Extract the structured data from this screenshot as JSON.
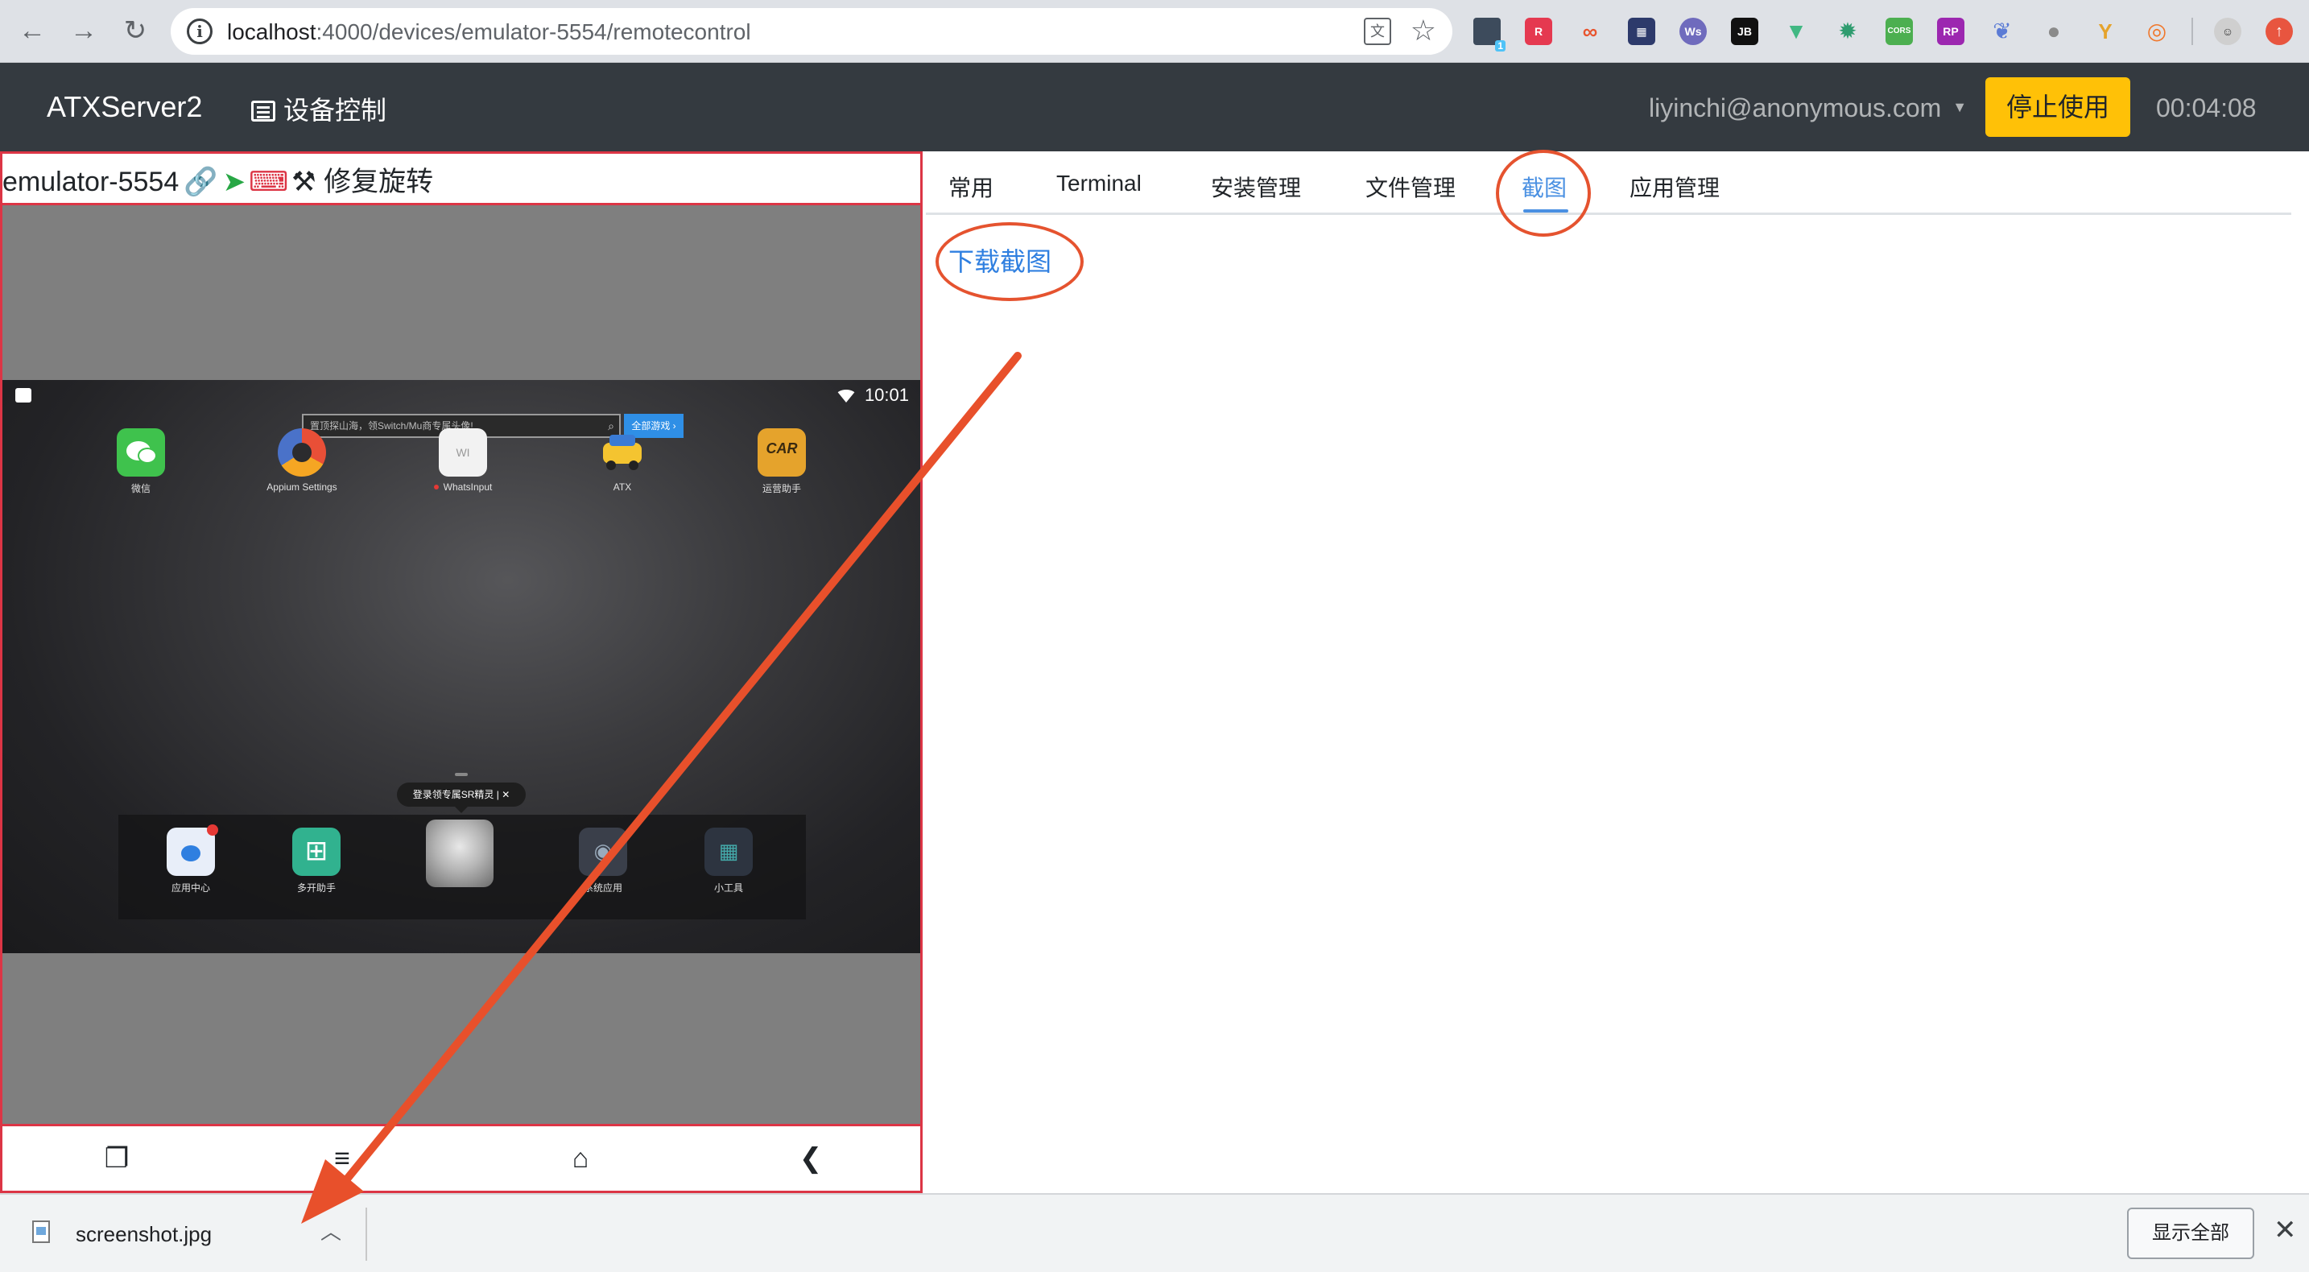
{
  "browser": {
    "url_host": "localhost",
    "url_rest": ":4000/devices/emulator-5554/remotecontrol",
    "extensions": [
      "zoom-ext",
      "rx-ext",
      "loop-ext",
      "img-ext",
      "ws-ext",
      "jb-ext",
      "vue-ext",
      "gear-ext",
      "cors-ext",
      "rp-ext",
      "feather-ext",
      "bulb-ext",
      "y-ext",
      "ring-ext",
      "avatar-ext",
      "update-ext"
    ],
    "ext_labels": {
      "jb": "JB",
      "cors": "CORS",
      "rp": "RP",
      "ws": "Ws",
      "badge": "1"
    }
  },
  "header": {
    "brand": "ATXServer2",
    "device_control": "设备控制",
    "user": "liyinchi@anonymous.com",
    "stop_button": "停止使用",
    "timer": "00:04:08"
  },
  "device": {
    "title": "emulator-5554",
    "fix_rotation": "修复旋转",
    "screen": {
      "time": "10:01",
      "search_placeholder": "置顶探山海，领Switch/Mu商专属头像!",
      "search_button": "全部游戏 ›",
      "apps": [
        {
          "label": "微信",
          "color": "#3fc24d"
        },
        {
          "label": "Appium Settings",
          "color": "#e94f37"
        },
        {
          "label": "WhatsInput",
          "color": "#f2f2f2"
        },
        {
          "label": "ATX",
          "color": "#f4c430"
        },
        {
          "label": "运营助手",
          "color": "#e5a32c"
        }
      ],
      "tooltip": "登录领专属SR精灵 | ✕",
      "dock": [
        {
          "label": "应用中心",
          "color": "#e8eef9"
        },
        {
          "label": "多开助手",
          "color": "#31b28f"
        },
        {
          "label": "",
          "color": "#9a9a9a"
        },
        {
          "label": "系统应用",
          "color": "#3a3f4a"
        },
        {
          "label": "小工具",
          "color": "#2d3440"
        }
      ],
      "wi_text": "WI",
      "car_text": "CAR"
    }
  },
  "tabs": [
    "常用",
    "Terminal",
    "安装管理",
    "文件管理",
    "截图",
    "应用管理"
  ],
  "active_tab": "截图",
  "download_link": "下载截图",
  "shelf": {
    "filename": "screenshot.jpg",
    "show_all": "显示全部"
  }
}
